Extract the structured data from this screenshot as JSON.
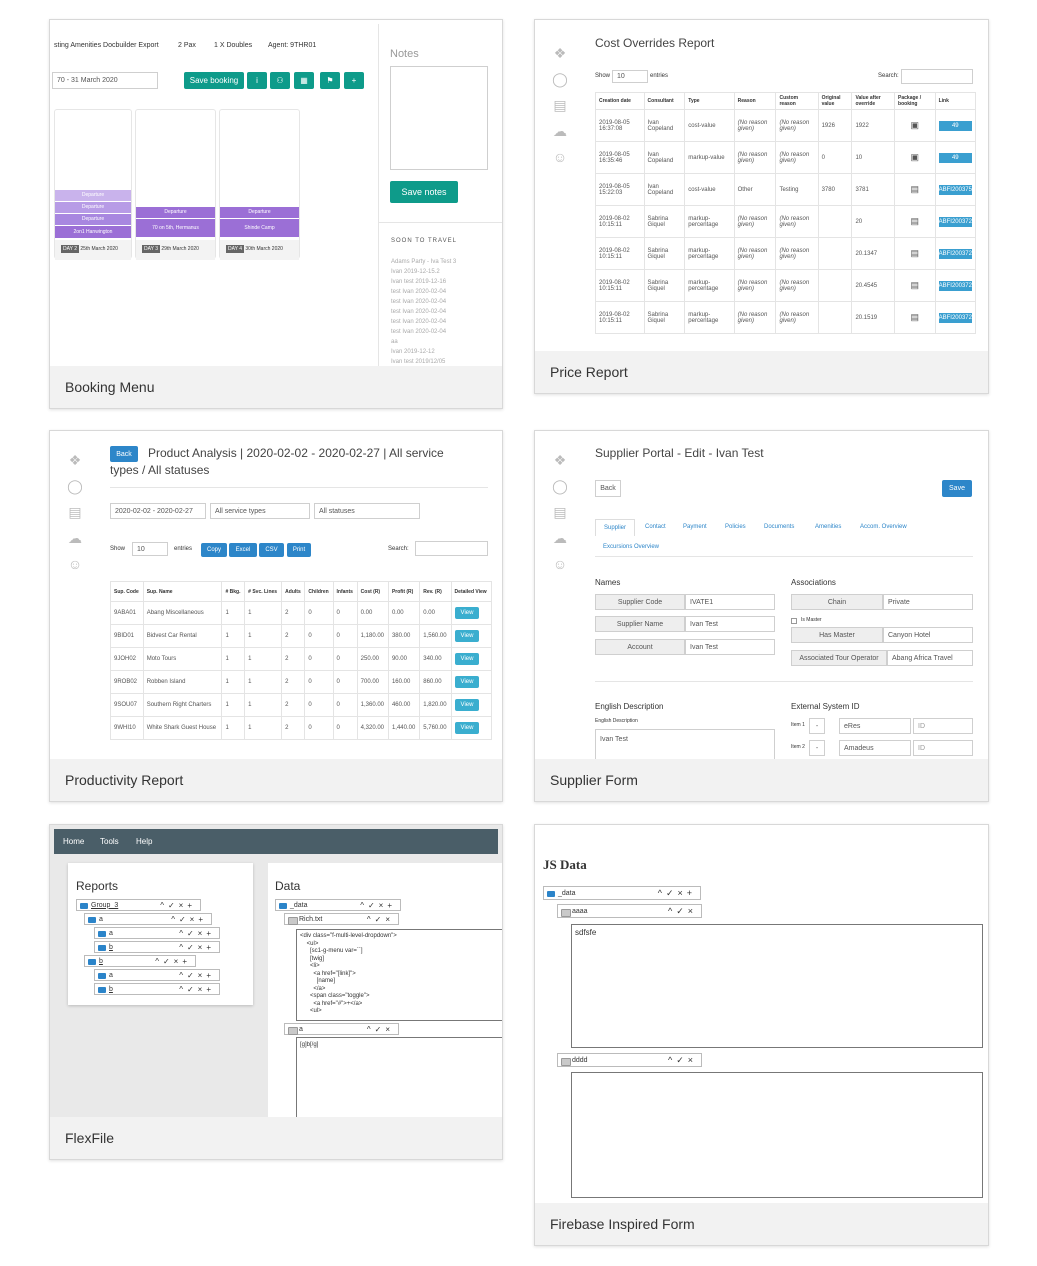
{
  "cards": {
    "booking": {
      "caption": "Booking Menu",
      "header_title": "sting Amenities Docbuilder Export",
      "pax": "2 Pax",
      "doubles": "1 X Doubles",
      "agent": "Agent: 9THR01",
      "date_range": "70 - 31 March 2020",
      "save_booking": "Save booking",
      "notes_label": "Notes",
      "save_notes": "Save notes",
      "soon_title": "SOON TO TRAVEL",
      "soon_items": [
        "Adams Party - Iva Test 3",
        "Ivan 2019-12-15.2",
        "Ivan test 2019-12-16",
        "test Ivan 2020-02-04",
        "test Ivan 2020-02-04",
        "test Ivan 2020-02-04",
        "test Ivan 2020-02-04",
        "test Ivan 2020-02-04",
        "aa",
        "Ivan 2019-12-12",
        "Ivan test 2019/12/05"
      ],
      "col1_events": [
        "Departure",
        "Departure",
        "Departure",
        "2on1 Hanwington"
      ],
      "col1_day": "DAY 2",
      "col1_date": "25th March 2020",
      "col2_events": [
        "Departure",
        "70 on 5th, Hermanus"
      ],
      "col2_day": "DAY 3",
      "col2_date": "29th March 2020",
      "col3_events": [
        "Departure",
        "Shinde Camp"
      ],
      "col3_day": "DAY 4",
      "col3_date": "30th March 2020"
    },
    "price": {
      "caption": "Price Report",
      "title": "Cost Overrides Report",
      "show": "Show",
      "entries_val": "10",
      "entries": "entries",
      "search": "Search:",
      "headers": [
        "Creation date",
        "Consultant",
        "Type",
        "Reason",
        "Custom reason",
        "Original value",
        "Value after override",
        "Package / booking",
        "Link"
      ],
      "rows": [
        [
          "2019-08-05 16:37:08",
          "Ivan Copeland",
          "cost-value",
          "(No reason given)",
          "(No reason given)",
          "1926",
          "1922",
          "box",
          "49"
        ],
        [
          "2019-08-05 16:35:46",
          "Ivan Copeland",
          "markup-value",
          "(No reason given)",
          "(No reason given)",
          "0",
          "10",
          "box",
          "49"
        ],
        [
          "2019-08-05 15:22:03",
          "Ivan Copeland",
          "cost-value",
          "Other",
          "Testing",
          "3780",
          "3781",
          "book",
          "ABFI200375"
        ],
        [
          "2019-08-02 10:15:11",
          "Sabrina Giquel",
          "markup-percentage",
          "(No reason given)",
          "(No reason given)",
          "",
          "20",
          "book",
          "ABFI200372"
        ],
        [
          "2019-08-02 10:15:11",
          "Sabrina Giquel",
          "markup-percentage",
          "(No reason given)",
          "(No reason given)",
          "",
          "20.1347",
          "book",
          "ABFI200372"
        ],
        [
          "2019-08-02 10:15:11",
          "Sabrina Giquel",
          "markup-percentage",
          "(No reason given)",
          "(No reason given)",
          "",
          "20.4545",
          "book",
          "ABFI200372"
        ],
        [
          "2019-08-02 10:15:11",
          "Sabrina Giquel",
          "markup-percentage",
          "(No reason given)",
          "(No reason given)",
          "",
          "20.1519",
          "book",
          "ABFI200372"
        ]
      ]
    },
    "productivity": {
      "caption": "Productivity Report",
      "back": "Back",
      "title": "Product Analysis | 2020-02-02 - 2020-02-27 | All service types / All statuses",
      "date_filter": "2020-02-02 - 2020-02-27",
      "service_filter": "All service types",
      "status_filter": "All statuses",
      "show": "Show",
      "entries_val": "10",
      "entries": "entries",
      "buttons": [
        "Copy",
        "Excel",
        "CSV",
        "Print"
      ],
      "search": "Search:",
      "headers": [
        "Sup. Code",
        "Sup. Name",
        "# Bkg.",
        "# Svc. Lines",
        "Adults",
        "Children",
        "Infants",
        "Cost (R)",
        "Profit (R)",
        "Rev. (R)",
        "Detailed View"
      ],
      "rows": [
        [
          "9ABA01",
          "Abang Miscellaneous",
          "1",
          "1",
          "2",
          "0",
          "0",
          "0.00",
          "0.00",
          "0.00"
        ],
        [
          "9BID01",
          "Bidvest Car Rental",
          "1",
          "1",
          "2",
          "0",
          "0",
          "1,180.00",
          "380.00",
          "1,560.00"
        ],
        [
          "9JOH02",
          "Moto Tours",
          "1",
          "1",
          "2",
          "0",
          "0",
          "250.00",
          "90.00",
          "340.00"
        ],
        [
          "9ROB02",
          "Robben Island",
          "1",
          "1",
          "2",
          "0",
          "0",
          "700.00",
          "160.00",
          "860.00"
        ],
        [
          "9SOU07",
          "Southern Right Charters",
          "1",
          "1",
          "2",
          "0",
          "0",
          "1,360.00",
          "460.00",
          "1,820.00"
        ],
        [
          "9WHI10",
          "White Shark Guest House",
          "1",
          "1",
          "2",
          "0",
          "0",
          "4,320.00",
          "1,440.00",
          "5,760.00"
        ]
      ],
      "view": "View"
    },
    "supplier": {
      "caption": "Supplier Form",
      "title": "Supplier Portal - Edit - Ivan Test",
      "back": "Back",
      "save": "Save",
      "tabs": [
        "Supplier",
        "Contact",
        "Payment",
        "Policies",
        "Documents",
        "Amenities",
        "Accom. Overview"
      ],
      "tab2": "Excursions Overview",
      "names_title": "Names",
      "supplier_code_label": "Supplier Code",
      "supplier_code": "IVATE1",
      "supplier_name_label": "Supplier Name",
      "supplier_name": "Ivan Test",
      "account_label": "Account",
      "account": "Ivan Test",
      "assoc_title": "Associations",
      "chain_label": "Chain",
      "chain": "Private",
      "is_master": "Is Master",
      "has_master_label": "Has Master",
      "has_master": "Canyon Hotel",
      "tour_op_label": "Associated Tour Operator",
      "tour_op": "Abang Africa Travel",
      "eng_title": "English Description",
      "eng_label": "English Description",
      "eng_value": "Ivan Test",
      "ext_title": "External System ID",
      "item1": "Item 1",
      "item1_sys": "eRes",
      "item2": "Item 2",
      "item2_sys": "Amadeus",
      "id_ph": "ID"
    },
    "flexfile": {
      "caption": "FlexFile",
      "nav": [
        "Home",
        "Tools",
        "Help"
      ],
      "reports_title": "Reports",
      "data_title": "Data",
      "tree": [
        "Group_3",
        "a",
        "a",
        "b",
        "b",
        "a",
        "b"
      ],
      "data_root": "_data",
      "rich": "Rich.txt",
      "rich_content": "<div class=\"f-multi-level-dropdown\">\n    <ul>\n      [sc1-g-menu var=``]\n      [twig]\n      <li>\n        <a href=\"[link]\">\n          [name]\n        </a>\n      <span class=\"toggle\">\n        <a href=\"#\">+</a>\n      <ul>",
      "a_file": "a",
      "a_content": "[g]b[/g]"
    },
    "firebase": {
      "caption": "Firebase Inspired Form",
      "title": "JS Data",
      "root": "_data",
      "node1": "aaaa",
      "node1_value": "sdfsfe",
      "node2": "dddd",
      "node2_value": ""
    }
  },
  "colors": {
    "teal": "#0e9b8a",
    "blue": "#2d86c9",
    "purple": "#9b6fd6",
    "dark_nav": "#4a5e68"
  }
}
